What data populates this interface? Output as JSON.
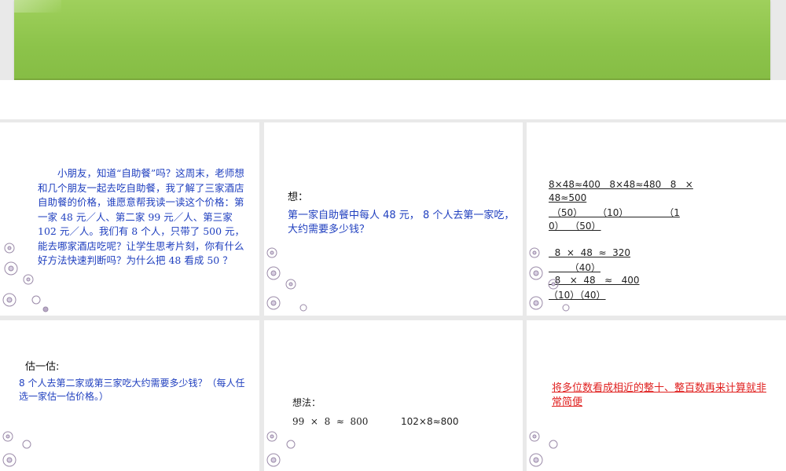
{
  "slide1": {
    "text": "小朋友，知道“自助餐”吗？这周末，老师想和几个朋友一起去吃自助餐，我了解了三家酒店自助餐的价格，谁愿意帮我读一读这个价格：第一家 48 元／人、第二家 99 元／人、第三家 102 元／人。我们有 8 个人，只带了 500 元，能去哪家酒店吃呢？让学生思考片刻，你有什么好方法快速判断吗？为什么把 48 看成 50 ？"
  },
  "slide2": {
    "title": "想：",
    "body": "第一家自助餐中每人 48 元， 8 个人去第一家吃，大约需要多少钱？"
  },
  "slide3": {
    "line1": "8×48≈400   8×48≈480   8   ×",
    "line2": "48≈500",
    "line3": " （50）     （10）            （1",
    "line4": "0）  （50）",
    "line5": "  8  ×  48  ≈  320",
    "line6": "       （40）",
    "line7": "  8   ×  48   ≈   400",
    "line8": "（10）（40）"
  },
  "slide4": {
    "title": "估一估:",
    "body": "8 个人去第二家或第三家吃大约需要多少钱？（每人任选一家估一估价格。）"
  },
  "slide5": {
    "title": "想法：",
    "eq1": "99  ×  8  ≈  800",
    "eq2": "102×8≈800"
  },
  "slide6": {
    "text": "将多位数看成相近的整十、整百数再来计算就非常简便"
  },
  "colors": {
    "banner": "#8cc34a",
    "blue_text": "#1f3fbf",
    "red_text": "#e0201f"
  },
  "decor_icon": "snowflake-flower-icon"
}
